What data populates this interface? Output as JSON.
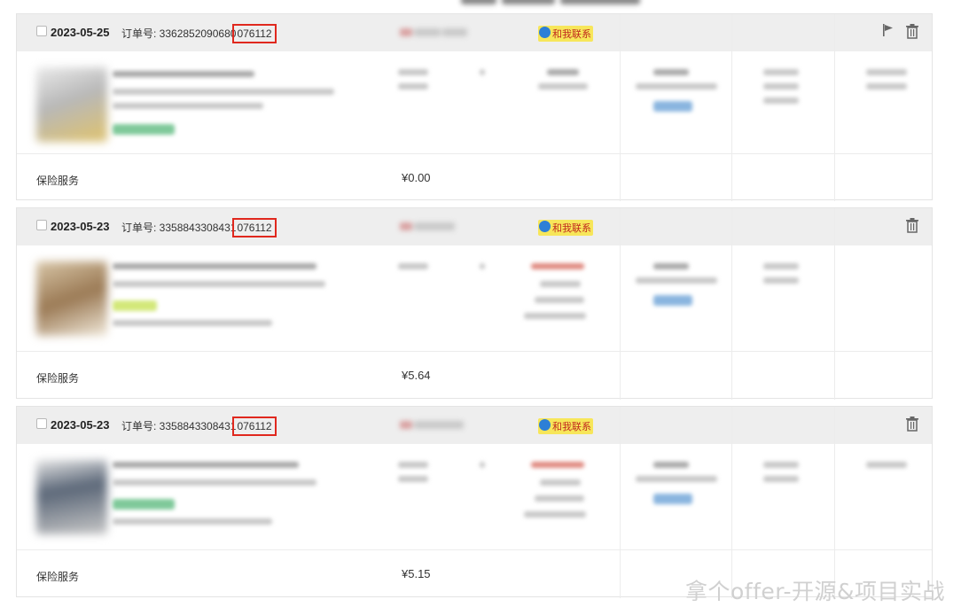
{
  "orders": [
    {
      "date": "2023-05-25",
      "order_prefix": "订单号: 3362852090680",
      "order_suffix": "076112",
      "contact": "和我联系",
      "has_flag": true,
      "insurance_label": "保险服务",
      "insurance_price": "¥0.00"
    },
    {
      "date": "2023-05-23",
      "order_prefix": "订单号: 3358843308431",
      "order_suffix": "076112",
      "contact": "和我联系",
      "has_flag": false,
      "insurance_label": "保险服务",
      "insurance_price": "¥5.64"
    },
    {
      "date": "2023-05-23",
      "order_prefix": "订单号: 3358843308431",
      "order_suffix": "076112",
      "contact": "和我联系",
      "has_flag": false,
      "insurance_label": "保险服务",
      "insurance_price": "¥5.15"
    }
  ],
  "watermark": "拿个offer-开源&项目实战",
  "colors": {
    "highlight": "#e0281e",
    "header_bg": "#eeeeee",
    "contact_bg": "#f7e65a"
  },
  "icons": [
    "flag-icon",
    "trash-icon",
    "checkbox"
  ]
}
